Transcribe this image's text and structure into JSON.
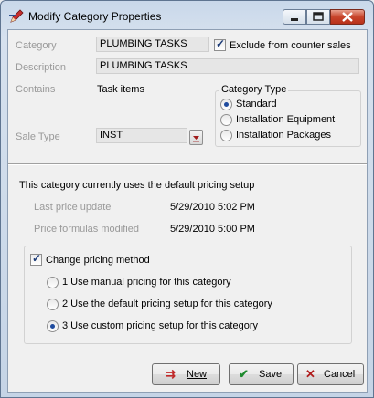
{
  "window": {
    "title": "Modify Category Properties"
  },
  "category": {
    "category_label": "Category",
    "category_value": "PLUMBING TASKS",
    "exclude_label": "Exclude from counter sales",
    "exclude_checked": true,
    "description_label": "Description",
    "description_value": "PLUMBING TASKS",
    "contains_label": "Contains",
    "contains_value": "Task items",
    "sale_type_label": "Sale Type",
    "sale_type_value": "INST"
  },
  "category_type": {
    "title": "Category Type",
    "options": [
      "Standard",
      "Installation Equipment",
      "Installation Packages"
    ],
    "selected": "Standard"
  },
  "pricing": {
    "status_text": "This category currently uses the default pricing setup",
    "last_price_update_label": "Last price update",
    "last_price_update_value": "5/29/2010 5:02 PM",
    "formulas_modified_label": "Price formulas modified",
    "formulas_modified_value": "5/29/2010 5:00 PM",
    "change_method_label": "Change pricing method",
    "change_method_checked": true,
    "methods": [
      "1 Use manual pricing for this category",
      "2 Use the default pricing setup for this category",
      "3 Use custom pricing setup for this category"
    ],
    "selected_method": "3 Use custom pricing setup for this category"
  },
  "buttons": {
    "new_label": "New",
    "save_label": "Save",
    "cancel_label": "Cancel"
  },
  "icons": {
    "app": "edit-pencil-icon",
    "new": "new-icon",
    "save": "checkmark-icon",
    "cancel": "x-icon",
    "dropdown": "chevron-down-icon"
  }
}
